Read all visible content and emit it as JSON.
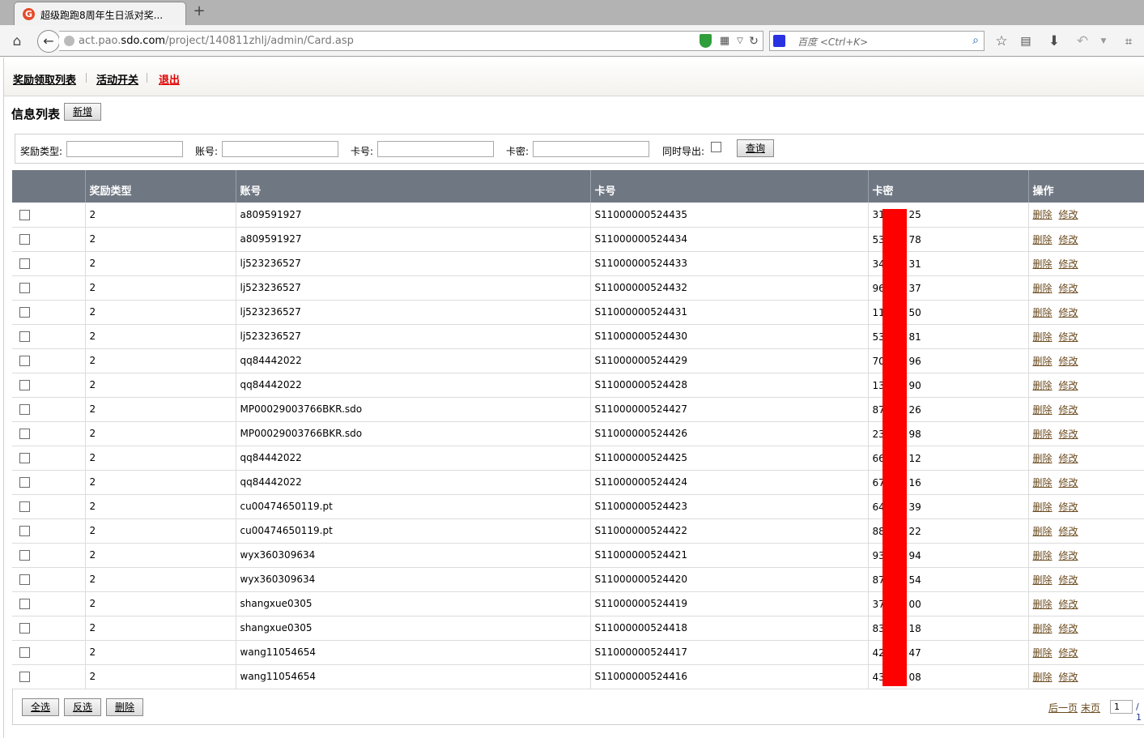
{
  "browser": {
    "tab_title": "超级跑跑8周年生日派对奖...",
    "new_tab": "+",
    "url_prefix": "act.pao.",
    "url_domain": "sdo.com",
    "url_path": "/project/140811zhlj/admin/Card.asp",
    "search_placeholder": "百度 <Ctrl+K>"
  },
  "topnav": {
    "items": [
      "奖励领取列表",
      "活动开关",
      "退出"
    ]
  },
  "list": {
    "title": "信息列表",
    "add_button": "新增"
  },
  "filters": {
    "reward_type_label": "奖励类型:",
    "account_label": "账号:",
    "card_no_label": "卡号:",
    "card_pwd_label": "卡密:",
    "export_label": "同时导出:",
    "query_button": "查询"
  },
  "table": {
    "columns": [
      "",
      "奖励类型",
      "账号",
      "卡号",
      "卡密",
      "操作"
    ],
    "delete_label": "删除",
    "edit_label": "修改",
    "rows": [
      {
        "type": "2",
        "account": "a809591927",
        "card": "S11000000524435",
        "pwd_a": "31",
        "pwd_b": "25"
      },
      {
        "type": "2",
        "account": "a809591927",
        "card": "S11000000524434",
        "pwd_a": "53",
        "pwd_b": "78"
      },
      {
        "type": "2",
        "account": "lj523236527",
        "card": "S11000000524433",
        "pwd_a": "34",
        "pwd_b": "31"
      },
      {
        "type": "2",
        "account": "lj523236527",
        "card": "S11000000524432",
        "pwd_a": "96",
        "pwd_b": "37"
      },
      {
        "type": "2",
        "account": "lj523236527",
        "card": "S11000000524431",
        "pwd_a": "11",
        "pwd_b": "50"
      },
      {
        "type": "2",
        "account": "lj523236527",
        "card": "S11000000524430",
        "pwd_a": "53",
        "pwd_b": "81"
      },
      {
        "type": "2",
        "account": "qq84442022",
        "card": "S11000000524429",
        "pwd_a": "70",
        "pwd_b": "96"
      },
      {
        "type": "2",
        "account": "qq84442022",
        "card": "S11000000524428",
        "pwd_a": "13",
        "pwd_b": "90"
      },
      {
        "type": "2",
        "account": "MP00029003766BKR.sdo",
        "card": "S11000000524427",
        "pwd_a": "87",
        "pwd_b": "26"
      },
      {
        "type": "2",
        "account": "MP00029003766BKR.sdo",
        "card": "S11000000524426",
        "pwd_a": "23",
        "pwd_b": "98"
      },
      {
        "type": "2",
        "account": "qq84442022",
        "card": "S11000000524425",
        "pwd_a": "66",
        "pwd_b": "12"
      },
      {
        "type": "2",
        "account": "qq84442022",
        "card": "S11000000524424",
        "pwd_a": "67",
        "pwd_b": "16"
      },
      {
        "type": "2",
        "account": "cu00474650119.pt",
        "card": "S11000000524423",
        "pwd_a": "64",
        "pwd_b": "39"
      },
      {
        "type": "2",
        "account": "cu00474650119.pt",
        "card": "S11000000524422",
        "pwd_a": "88",
        "pwd_b": "22"
      },
      {
        "type": "2",
        "account": "wyx360309634",
        "card": "S11000000524421",
        "pwd_a": "93",
        "pwd_b": "94"
      },
      {
        "type": "2",
        "account": "wyx360309634",
        "card": "S11000000524420",
        "pwd_a": "87",
        "pwd_b": "54"
      },
      {
        "type": "2",
        "account": "shangxue0305",
        "card": "S11000000524419",
        "pwd_a": "37",
        "pwd_b": "00"
      },
      {
        "type": "2",
        "account": "shangxue0305",
        "card": "S11000000524418",
        "pwd_a": "83",
        "pwd_b": "18"
      },
      {
        "type": "2",
        "account": "wang11054654",
        "card": "S11000000524417",
        "pwd_a": "42",
        "pwd_b": "47"
      },
      {
        "type": "2",
        "account": "wang11054654",
        "card": "S11000000524416",
        "pwd_a": "43",
        "pwd_b": "08"
      }
    ]
  },
  "footer": {
    "select_all": "全选",
    "invert": "反选",
    "delete": "删除",
    "next_page": "后一页",
    "last_page": "末页",
    "page_value": "1",
    "total": "/ 1"
  },
  "colors": {
    "header_bg": "#6f7782",
    "logout": "#e00000",
    "redaction": "#ff0000",
    "op_link": "#6b4a1e"
  }
}
